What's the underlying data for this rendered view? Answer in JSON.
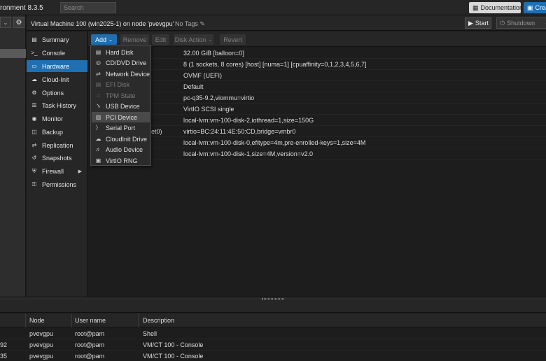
{
  "topbar": {
    "app_title": "ronment 8.3.5",
    "search_placeholder": "Search",
    "documentation_label": "Documentation",
    "create_label": "Crea"
  },
  "vm": {
    "title": "Virtual Machine 100 (win2025-1) on node 'pvevgpu'",
    "tags_label": "No Tags",
    "start_label": "Start",
    "shutdown_label": "Shutdown"
  },
  "nav": {
    "items": [
      {
        "label": "Summary",
        "icon": "summary-icon"
      },
      {
        "label": "Console",
        "icon": "console-icon"
      },
      {
        "label": "Hardware",
        "icon": "monitor-icon",
        "active": true
      },
      {
        "label": "Cloud-Init",
        "icon": "cloud-icon"
      },
      {
        "label": "Options",
        "icon": "gear-icon"
      },
      {
        "label": "Task History",
        "icon": "list-icon"
      },
      {
        "label": "Monitor",
        "icon": "eye-icon"
      },
      {
        "label": "Backup",
        "icon": "floppy-icon"
      },
      {
        "label": "Replication",
        "icon": "retweet-icon"
      },
      {
        "label": "Snapshots",
        "icon": "history-icon"
      },
      {
        "label": "Firewall",
        "icon": "shield-icon"
      },
      {
        "label": "Permissions",
        "icon": "unlock-icon"
      }
    ]
  },
  "toolbar": {
    "add_label": "Add",
    "remove_label": "Remove",
    "edit_label": "Edit",
    "disk_action_label": "Disk Action",
    "revert_label": "Revert"
  },
  "add_menu": {
    "items": [
      {
        "label": "Hard Disk",
        "icon": "hdd-icon",
        "disabled": false
      },
      {
        "label": "CD/DVD Drive",
        "icon": "cdrom-icon",
        "disabled": false
      },
      {
        "label": "Network Device",
        "icon": "network-icon",
        "disabled": false
      },
      {
        "label": "EFI Disk",
        "icon": "hdd-icon",
        "disabled": true
      },
      {
        "label": "TPM State",
        "icon": "chip-icon",
        "disabled": true
      },
      {
        "label": "USB Device",
        "icon": "usb-icon",
        "disabled": false
      },
      {
        "label": "PCI Device",
        "icon": "pci-icon",
        "disabled": false,
        "hover": true
      },
      {
        "label": "Serial Port",
        "icon": "terminal-icon",
        "disabled": false
      },
      {
        "label": "CloudInit Drive",
        "icon": "cloud-icon",
        "disabled": false
      },
      {
        "label": "Audio Device",
        "icon": "volume-icon",
        "disabled": false
      },
      {
        "label": "VirtIO RNG",
        "icon": "rng-icon",
        "disabled": false
      }
    ]
  },
  "hardware": {
    "rows": [
      {
        "key": "",
        "value": "32.00 GiB [balloon=0]"
      },
      {
        "key": "",
        "value": "8 (1 sockets, 8 cores) [host] [numa=1] [cpuaffinity=0,1,2,3,4,5,6,7]"
      },
      {
        "key": "",
        "value": "OVMF (UEFI)"
      },
      {
        "key": "",
        "value": "Default"
      },
      {
        "key": "",
        "value": "pc-q35-9.2,viommu=virtio"
      },
      {
        "key": "",
        "value": "VirtIO SCSI single"
      },
      {
        "key": "",
        "value": "local-lvm:vm-100-disk-2,iothread=1,size=150G"
      },
      {
        "key": "et0)",
        "value": "virtio=BC:24:11:4E:50:CD,bridge=vmbr0"
      },
      {
        "key": "",
        "value": "local-lvm:vm-100-disk-0,efitype=4m,pre-enrolled-keys=1,size=4M"
      },
      {
        "key": "",
        "value": "local-lvm:vm-100-disk-1,size=4M,version=v2.0"
      }
    ]
  },
  "tasks": {
    "columns": [
      "Node",
      "User name",
      "Description"
    ],
    "rows": [
      {
        "id": "",
        "node": "pvevgpu",
        "user": "root@pam",
        "description": "Shell"
      },
      {
        "id": "92",
        "node": "pvevgpu",
        "user": "root@pam",
        "description": "VM/CT 100 - Console"
      },
      {
        "id": "35",
        "node": "pvevgpu",
        "user": "root@pam",
        "description": "VM/CT 100 - Console"
      }
    ]
  }
}
